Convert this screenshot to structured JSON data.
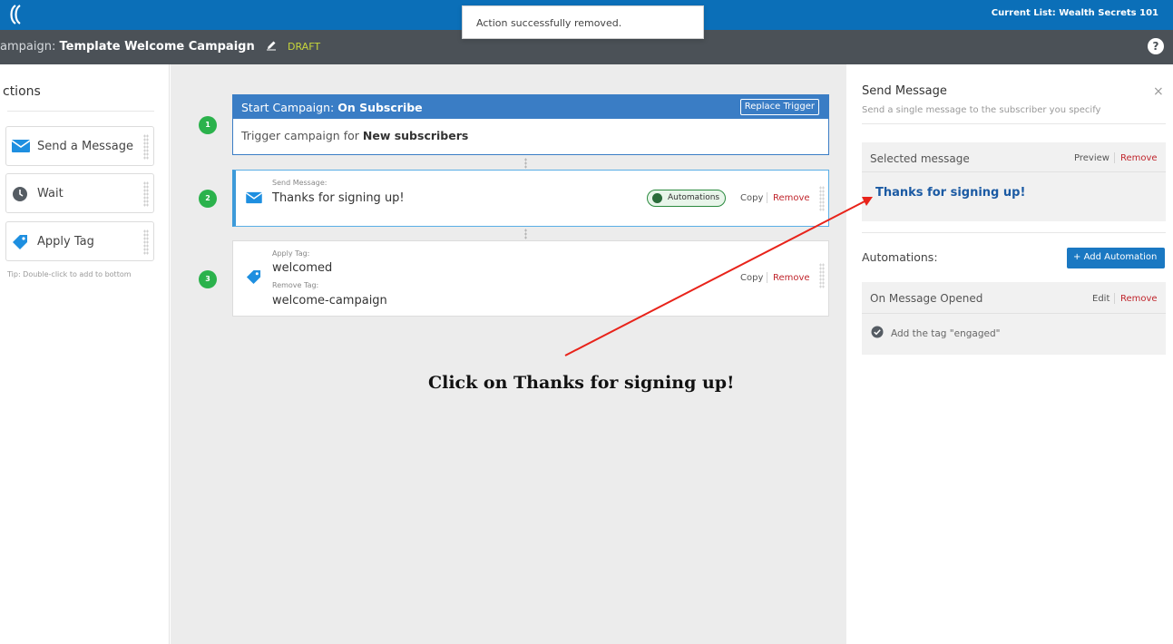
{
  "topbar": {
    "current_list": "Current List: Wealth Secrets 101"
  },
  "toast": {
    "message": "Action successfully removed."
  },
  "campaign": {
    "label": "ampaign:",
    "name": "Template Welcome Campaign",
    "status": "DRAFT",
    "help": "?"
  },
  "actions": {
    "title": "ctions",
    "items": [
      {
        "label": "Send a Message",
        "icon": "envelope-icon"
      },
      {
        "label": "Wait",
        "icon": "clock-icon"
      },
      {
        "label": "Apply Tag",
        "icon": "tag-icon"
      }
    ],
    "tip": "Tip: Double-click to add to bottom"
  },
  "steps": [
    {
      "number": "1",
      "title_prefix": "Start Campaign:",
      "title_value": "On Subscribe",
      "button": "Replace Trigger",
      "body_prefix": "Trigger campaign for",
      "body_value": "New subscribers"
    },
    {
      "number": "2",
      "label": "Send Message:",
      "value": "Thanks for signing up!",
      "badge": "Automations",
      "copy": "Copy",
      "remove": "Remove"
    },
    {
      "number": "3",
      "label": "Apply Tag:",
      "value": "welcomed",
      "label2": "Remove Tag:",
      "value2": "welcome-campaign",
      "copy": "Copy",
      "remove": "Remove"
    }
  ],
  "right_panel": {
    "title": "Send Message",
    "subtitle": "Send a single message to the subscriber you specify",
    "close": "×",
    "selected_label": "Selected message",
    "preview": "Preview",
    "remove": "Remove",
    "selected_message": "Thanks for signing up!",
    "automations_label": "Automations:",
    "add_automation": "Add Automation",
    "automation_trigger": "On Message Opened",
    "edit": "Edit",
    "automation_remove": "Remove",
    "automation_rule": "Add the tag \"engaged\""
  },
  "annotation": {
    "text": "Click on Thanks for signing up!"
  },
  "colors": {
    "topbar": "#0b6fb8",
    "header": "#4b5157",
    "accent_blue": "#3a7dc5",
    "step_green": "#2bb24c",
    "remove_red": "#c0262d",
    "arrow_red": "#e8231a"
  }
}
